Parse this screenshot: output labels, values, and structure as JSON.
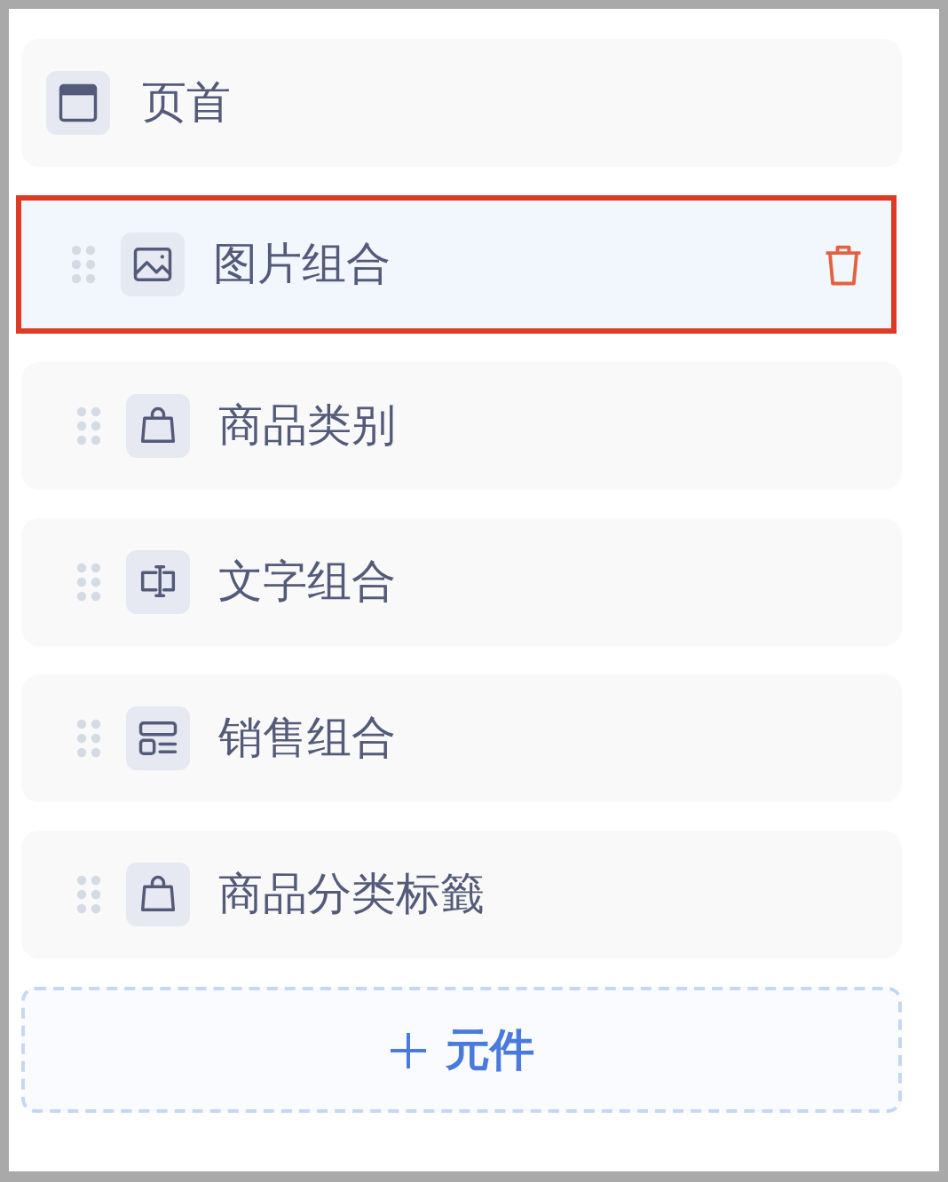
{
  "header": {
    "label": "页首"
  },
  "components": [
    {
      "label": "图片组合",
      "kind": "image",
      "selected": true
    },
    {
      "label": "商品类别",
      "kind": "bag",
      "selected": false
    },
    {
      "label": "文字组合",
      "kind": "text",
      "selected": false
    },
    {
      "label": "销售组合",
      "kind": "sales",
      "selected": false
    },
    {
      "label": "商品分类标籤",
      "kind": "bag",
      "selected": false
    }
  ],
  "add_button": {
    "label": "元件"
  }
}
